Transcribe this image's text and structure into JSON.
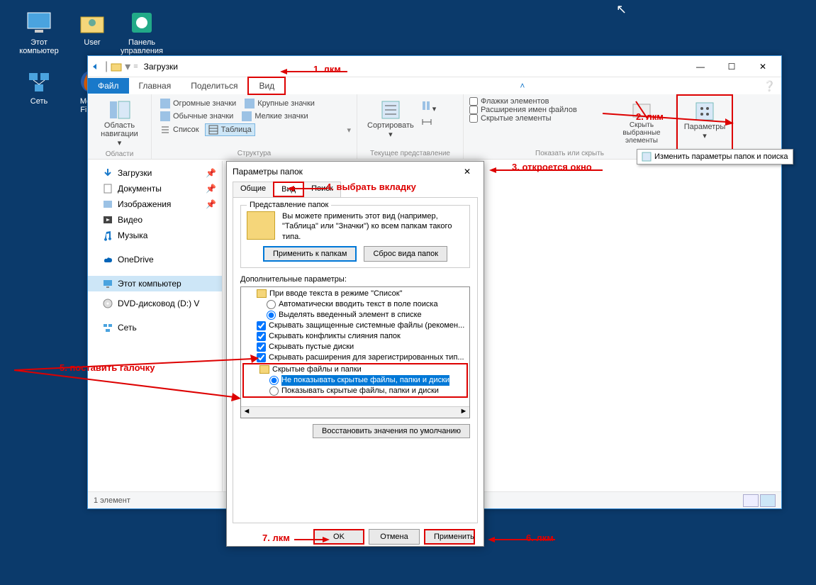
{
  "desktop": {
    "icons": [
      {
        "label": "Этот компьютер"
      },
      {
        "label": "User"
      },
      {
        "label": "Панель управления"
      },
      {
        "label": "Сеть"
      },
      {
        "label": "Mozilla Firefox"
      }
    ]
  },
  "explorer": {
    "title": "Загрузки",
    "tabs": {
      "file": "Файл",
      "home": "Главная",
      "share": "Поделиться",
      "view": "Вид"
    },
    "ribbon": {
      "nav_pane": "Область навигации",
      "group_areas": "Области",
      "layouts": {
        "huge": "Огромные значки",
        "large": "Крупные значки",
        "medium": "Обычные значки",
        "small": "Мелкие значки",
        "list": "Список",
        "table": "Таблица"
      },
      "group_layout": "Структура",
      "sort": "Сортировать",
      "group_view": "Текущее представление",
      "checks": {
        "item_checks": "Флажки элементов",
        "extensions": "Расширения имен файлов",
        "hidden": "Скрытые элементы"
      },
      "hide_selected": "Скрыть выбранные элементы",
      "group_show": "Показать или скрыть",
      "options": "Параметры"
    },
    "tooltip": "Изменить параметры папок и поиска",
    "nav": [
      "Загрузки",
      "Документы",
      "Изображения",
      "Видео",
      "Музыка",
      "OneDrive",
      "Этот компьютер",
      "DVD-дисковод (D:) V",
      "Сеть"
    ],
    "status": "1 элемент"
  },
  "dialog": {
    "title": "Параметры папок",
    "tabs": {
      "general": "Общие",
      "view": "Вид",
      "search": "Поиск"
    },
    "fieldset_title": "Представление папок",
    "fieldset_desc": "Вы можете применить этот вид (например, \"Таблица\" или \"Значки\") ко всем папкам такого типа.",
    "apply_folders": "Применить к папкам",
    "reset_folders": "Сброс вида папок",
    "adv_label": "Дополнительные параметры:",
    "adv": {
      "root": "При вводе текста в режиме \"Список\"",
      "r1": "Автоматически вводить текст в поле поиска",
      "r2": "Выделять введенный элемент в списке",
      "c1": "Скрывать защищенные системные файлы (рекомен...",
      "c2": "Скрывать конфликты слияния папок",
      "c3": "Скрывать пустые диски",
      "c4": "Скрывать расширения для зарегистрированных тип...",
      "hidden_root": "Скрытые файлы и папки",
      "h1": "Не показывать скрытые файлы, папки и диски",
      "h2": "Показывать скрытые файлы, папки и диски"
    },
    "restore": "Восстановить значения по умолчанию",
    "ok": "OK",
    "cancel": "Отмена",
    "apply": "Применить"
  },
  "annotations": {
    "a1": "1. лкм",
    "a2": "2. лкм",
    "a3": "3. откроется окно",
    "a4": "4. выбрать вкладку",
    "a5": "5. поставить галочку",
    "a6": "6. лкм",
    "a7": "7. лкм"
  }
}
